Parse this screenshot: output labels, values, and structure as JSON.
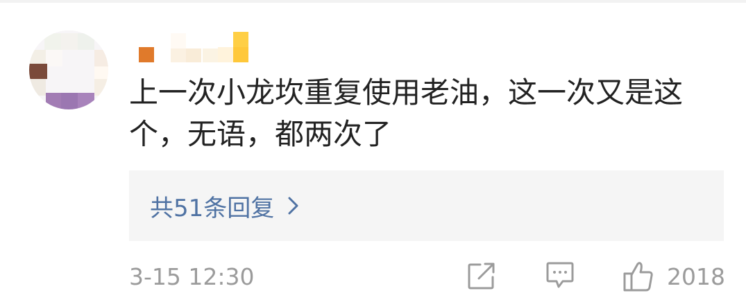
{
  "comment": {
    "text": "上一次小龙坎重复使用老油，这一次又是这个，无语，都两次了",
    "reply_link_label": "共51条回复",
    "timestamp": "3-15 12:30",
    "like_count": "2018"
  },
  "icons": {
    "reply_chevron": "chevron-right-icon",
    "share": "share-icon",
    "comment": "comment-icon",
    "like": "thumbs-up-icon"
  },
  "colors": {
    "text": "#222222",
    "link": "#4f72a3",
    "meta": "#9b9b9b",
    "reply_bg": "#f5f5f5"
  }
}
